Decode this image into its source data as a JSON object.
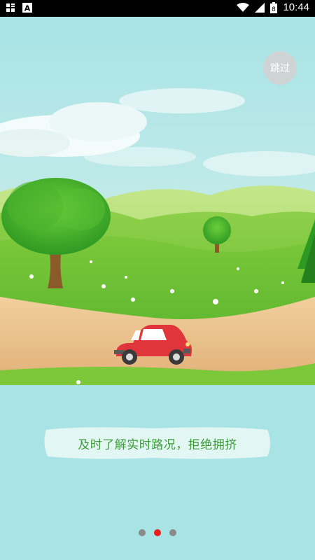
{
  "status_bar": {
    "time": "10:44",
    "battery_level": "8",
    "left_icons": [
      "grid-notification-icon",
      "text-a-icon"
    ],
    "right_icons": [
      "wifi-icon",
      "signal-icon",
      "battery-icon"
    ]
  },
  "skip_button": {
    "label": "跳过"
  },
  "caption": {
    "text": "及时了解实时路况，拒绝拥挤"
  },
  "pager": {
    "pages": 3,
    "active_index": 1
  },
  "colors": {
    "background": "#a8e3e6",
    "caption_text": "#3d9a3a",
    "active_dot": "#e8201d",
    "inactive_dot": "#8a8a8a",
    "car": "#e0353a"
  },
  "illustration": {
    "subject": "red car on dirt road through green hills with trees"
  }
}
